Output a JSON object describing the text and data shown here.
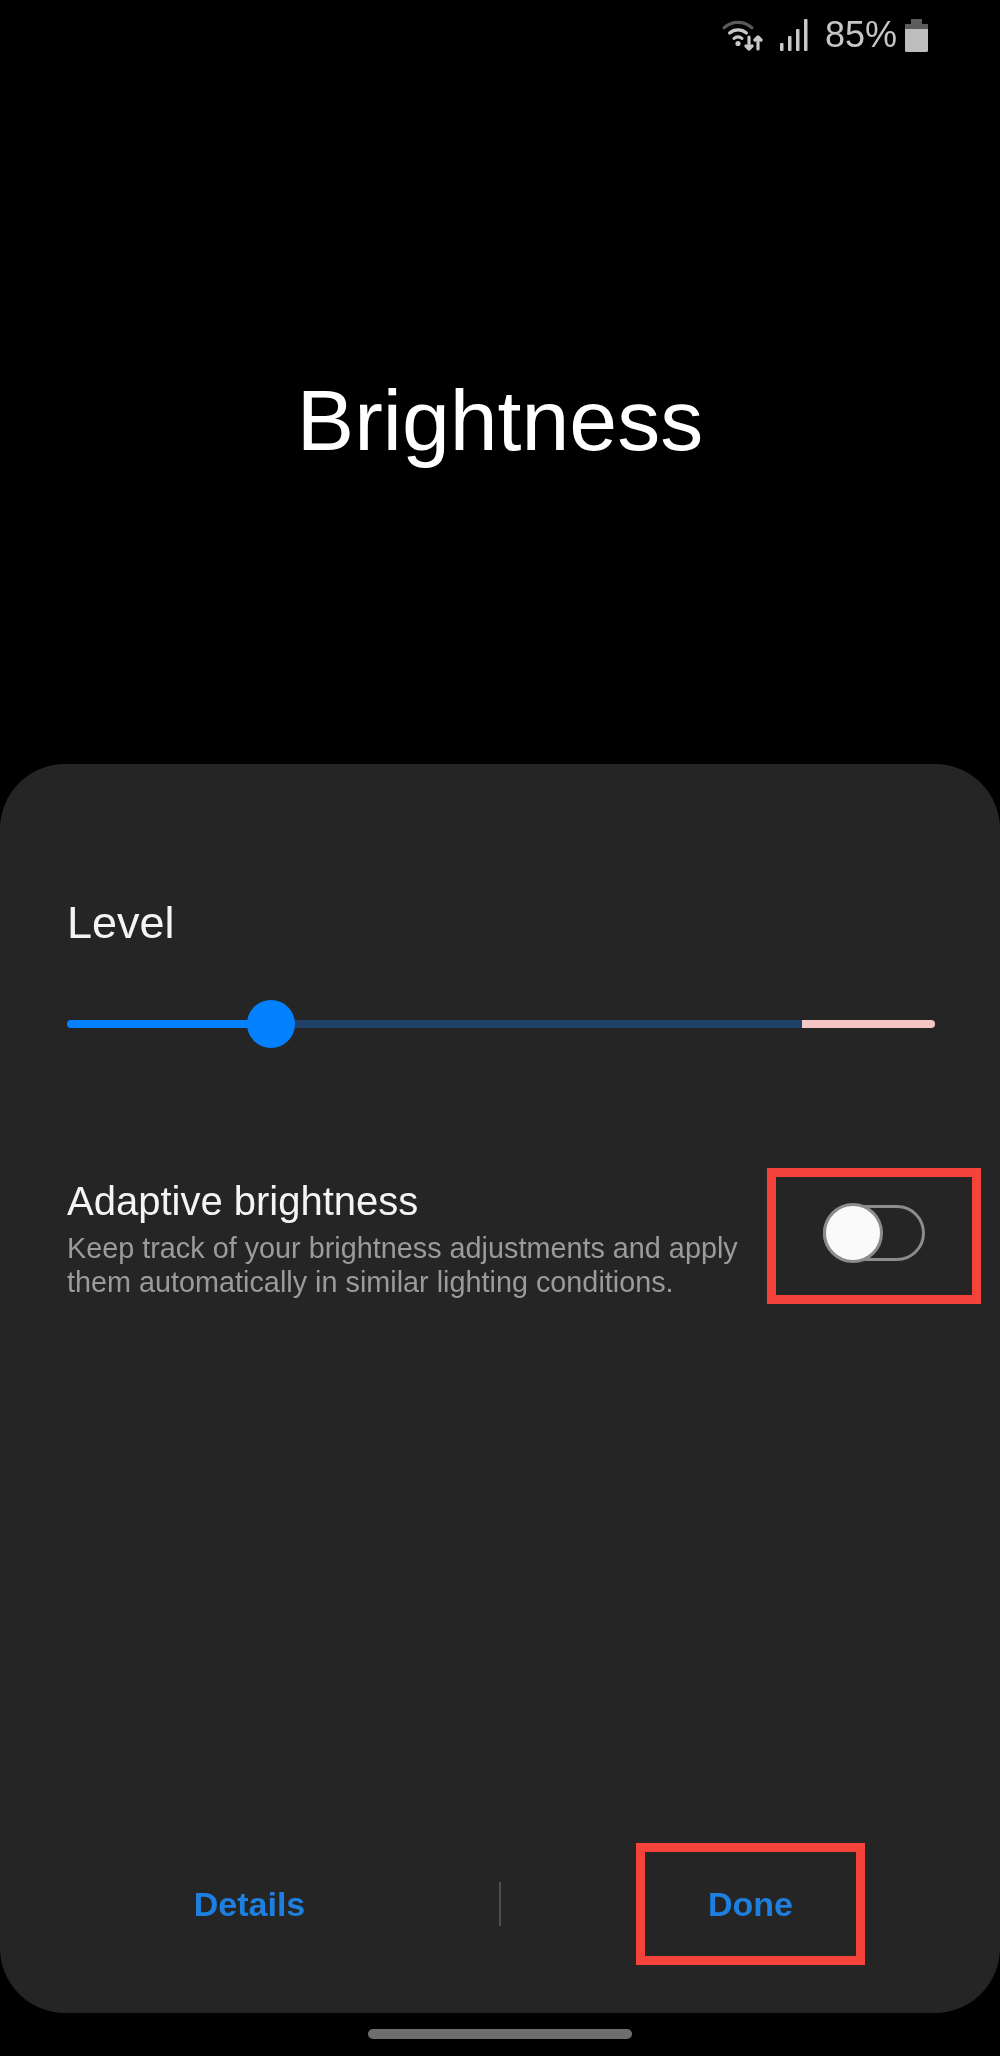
{
  "status_bar": {
    "battery_percent": "85%"
  },
  "header": {
    "title": "Brightness"
  },
  "panel": {
    "level_label": "Level",
    "slider": {
      "level": 0.235
    },
    "adaptive_brightness": {
      "title": "Adaptive brightness",
      "description": "Keep track of your brightness adjustments and apply them automatically in similar lighting conditions.",
      "on": false,
      "highlighted": true
    },
    "buttons": [
      {
        "label": "Details",
        "highlighted": false
      },
      {
        "label": "Done",
        "highlighted": true
      }
    ]
  }
}
